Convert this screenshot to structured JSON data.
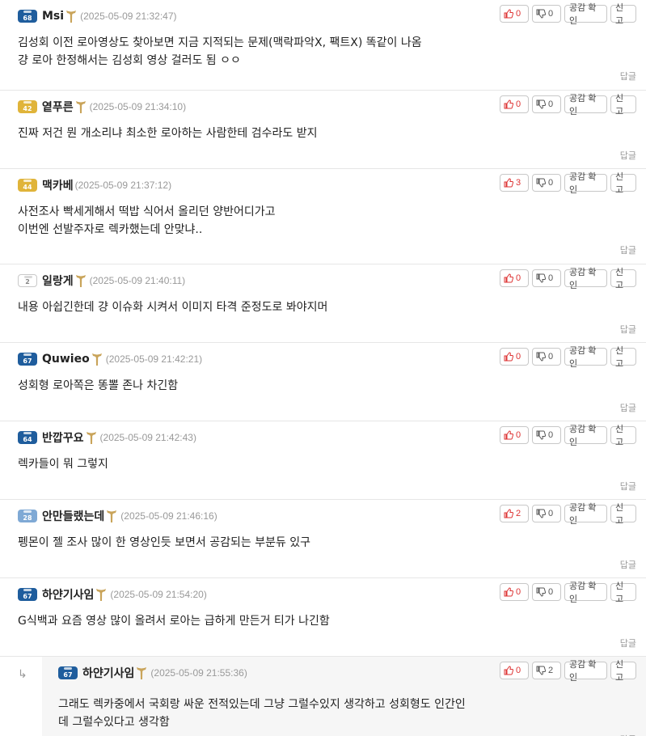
{
  "ui": {
    "reply_label": "답글",
    "empathy_label": "공감 확인",
    "report_label": "신고",
    "reply_arrow": "↳"
  },
  "comments": [
    {
      "nick": "Msi",
      "level": "68",
      "level_color": "blue",
      "has_badge": true,
      "date": "(2025-05-09 21:32:47)",
      "up": "0",
      "down": "0",
      "lines": [
        "김성회 이전 로아영상도 찾아보면 지금 지적되는 문제(맥락파악X, 팩트X) 똑같이 나옴",
        "걍 로아 한정해서는 김성회 영상 걸러도 됨 ㅇㅇ"
      ]
    },
    {
      "nick": "옅푸른",
      "level": "42",
      "level_color": "gold",
      "has_badge": true,
      "date": "(2025-05-09 21:34:10)",
      "up": "0",
      "down": "0",
      "lines": [
        "진짜 저건 뭔 개소리냐 최소한 로아하는 사람한테 검수라도 받지"
      ]
    },
    {
      "nick": "맥카베",
      "level": "44",
      "level_color": "gold",
      "has_badge": false,
      "date": "(2025-05-09 21:37:12)",
      "up": "3",
      "down": "0",
      "lines": [
        "사전조사 빡세게해서 떡밥 식어서 올리던 양반어디가고",
        "이번엔 선발주자로 렉카했는데 안맞냐.."
      ]
    },
    {
      "nick": "일랑게",
      "level": "2",
      "level_color": "gray",
      "has_badge": true,
      "date": "(2025-05-09 21:40:11)",
      "up": "0",
      "down": "0",
      "lines": [
        "내용 아쉽긴한데 걍 이슈화 시켜서 이미지 타격 준정도로 봐야지머"
      ]
    },
    {
      "nick": "Quwieo",
      "level": "67",
      "level_color": "blue",
      "has_badge": true,
      "date": "(2025-05-09 21:42:21)",
      "up": "0",
      "down": "0",
      "lines": [
        "성회형 로아쪽은 똥뽈 존나 차긴함"
      ]
    },
    {
      "nick": "반깝꾸요",
      "level": "64",
      "level_color": "blue",
      "has_badge": true,
      "date": "(2025-05-09 21:42:43)",
      "up": "0",
      "down": "0",
      "lines": [
        "렉카들이 뭐 그렇지"
      ]
    },
    {
      "nick": "안만들랬는데",
      "level": "28",
      "level_color": "lightblue",
      "has_badge": true,
      "date": "(2025-05-09 21:46:16)",
      "up": "2",
      "down": "0",
      "lines": [
        "펭몬이 젤 조사 많이 한 영상인듯 보면서 공감되는 부분듀 있구"
      ]
    },
    {
      "nick": "하얀기사임",
      "level": "67",
      "level_color": "blue",
      "has_badge": true,
      "date": "(2025-05-09 21:54:20)",
      "up": "0",
      "down": "0",
      "lines": [
        "G식백과 요즘 영상 많이 올려서 로아는 급하게 만든거 티가 나긴함"
      ]
    },
    {
      "nick": "하얀기사임",
      "level": "67",
      "level_color": "blue",
      "has_badge": true,
      "date": "(2025-05-09 21:55:36)",
      "up": "0",
      "down": "2",
      "lines": [
        "그래도 렉카중에서 국회랑 싸운 전적있는데 그냥 그럴수있지 생각하고 성회형도 인간인",
        "데 그럴수있다고 생각함"
      ]
    }
  ]
}
